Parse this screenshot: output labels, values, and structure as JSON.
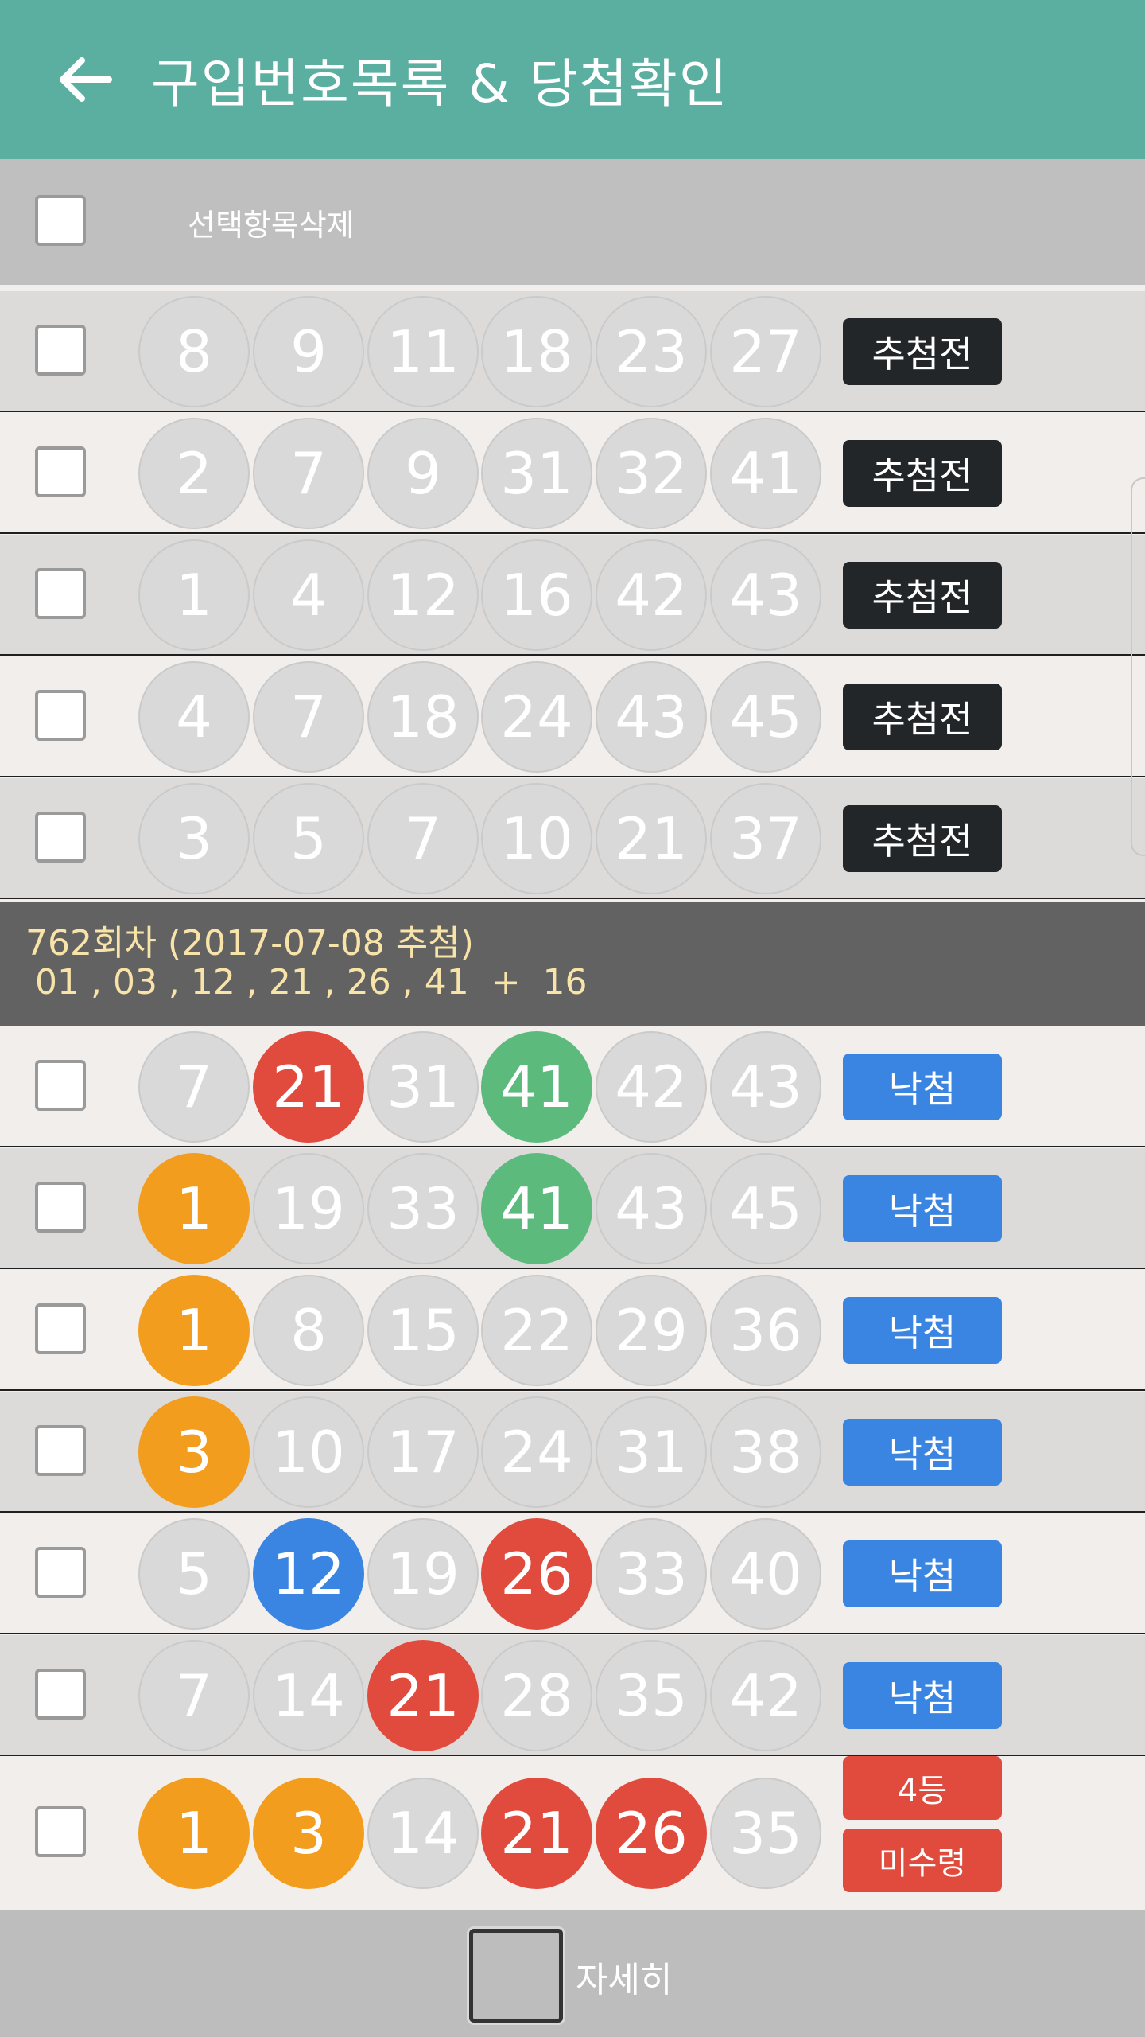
{
  "header": {
    "title": "구입번호목록 & 당첨확인"
  },
  "delete_bar": {
    "label": "선택항목삭제"
  },
  "pending_rows": [
    {
      "numbers": [
        "8",
        "9",
        "11",
        "18",
        "23",
        "27"
      ],
      "status": "추첨전"
    },
    {
      "numbers": [
        "2",
        "7",
        "9",
        "31",
        "32",
        "41"
      ],
      "status": "추첨전"
    },
    {
      "numbers": [
        "1",
        "4",
        "12",
        "16",
        "42",
        "43"
      ],
      "status": "추첨전"
    },
    {
      "numbers": [
        "4",
        "7",
        "18",
        "24",
        "43",
        "45"
      ],
      "status": "추첨전"
    },
    {
      "numbers": [
        "3",
        "5",
        "7",
        "10",
        "21",
        "37"
      ],
      "status": "추첨전"
    }
  ],
  "draw": {
    "title": "762회차 (2017-07-08 추첨)",
    "numbers_line": "01 , 03 , 12 , 21 , 26 , 41  +  16"
  },
  "result_rows": [
    {
      "numbers": [
        "7",
        "21",
        "31",
        "41",
        "42",
        "43"
      ],
      "colors": [
        "gray",
        "red",
        "gray",
        "green",
        "gray",
        "gray"
      ],
      "status": "낙첨"
    },
    {
      "numbers": [
        "1",
        "19",
        "33",
        "41",
        "43",
        "45"
      ],
      "colors": [
        "orange",
        "gray",
        "gray",
        "green",
        "gray",
        "gray"
      ],
      "status": "낙첨"
    },
    {
      "numbers": [
        "1",
        "8",
        "15",
        "22",
        "29",
        "36"
      ],
      "colors": [
        "orange",
        "gray",
        "gray",
        "gray",
        "gray",
        "gray"
      ],
      "status": "낙첨"
    },
    {
      "numbers": [
        "3",
        "10",
        "17",
        "24",
        "31",
        "38"
      ],
      "colors": [
        "orange",
        "gray",
        "gray",
        "gray",
        "gray",
        "gray"
      ],
      "status": "낙첨"
    },
    {
      "numbers": [
        "5",
        "12",
        "19",
        "26",
        "33",
        "40"
      ],
      "colors": [
        "gray",
        "blue",
        "gray",
        "red",
        "gray",
        "gray"
      ],
      "status": "낙첨"
    },
    {
      "numbers": [
        "7",
        "14",
        "21",
        "28",
        "35",
        "42"
      ],
      "colors": [
        "gray",
        "gray",
        "red",
        "gray",
        "gray",
        "gray"
      ],
      "status": "낙첨"
    },
    {
      "numbers": [
        "1",
        "3",
        "14",
        "21",
        "26",
        "35"
      ],
      "colors": [
        "orange",
        "orange",
        "gray",
        "red",
        "red",
        "gray"
      ],
      "status": "4등",
      "status2": "미수령"
    }
  ],
  "bottom_bar": {
    "label": "자세히"
  },
  "colors": {
    "appbar": "#5aafa0",
    "ball_gray": "#d9d9d9",
    "ball_red": "#e04b3d",
    "ball_green": "#5cbb7c",
    "ball_orange": "#f29d1e",
    "ball_blue": "#3a84e2",
    "pending_badge": "#222629",
    "lose_badge": "#3a84e2"
  },
  "icons": {
    "back": "arrow-left-icon"
  }
}
